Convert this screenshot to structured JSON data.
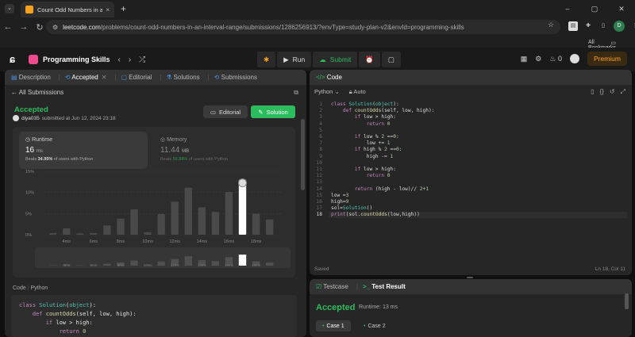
{
  "browser": {
    "tab_title": "Count Odd Numbers in an Inte",
    "tab_close": "×",
    "new_tab": "+",
    "url_host": "leetcode.com",
    "url_path": "/problems/count-odd-numbers-in-an-interval-range/submissions/1286256913/?envType=study-plan-v2&envId=programming-skills",
    "bookmarks_label": "All Bookmarks",
    "profile_letter": "D",
    "min": "–",
    "max": "▢",
    "close": "✕"
  },
  "toolbar": {
    "study_plan": "Programming Skills",
    "run": "Run",
    "submit": "Submit",
    "streak": "0",
    "premium": "Premium"
  },
  "left_panel": {
    "tabs": [
      "Description",
      "Accepted",
      "Editorial",
      "Solutions",
      "Submissions"
    ],
    "all_submissions": "All Submissions",
    "status": "Accepted",
    "user": "diya035",
    "submitted_at": "submitted at Jun 12, 2024 23:18",
    "editorial_btn": "Editorial",
    "solution_btn": "Solution",
    "runtime": {
      "label": "Runtime",
      "value": "16",
      "unit": "ms",
      "beats_prefix": "Beats",
      "beats_pct": "34.95%",
      "beats_suffix": "of users with Python"
    },
    "memory": {
      "label": "Memory",
      "value": "11.44",
      "unit": "MB",
      "beats_prefix": "Beats",
      "beats_pct": "50.88%",
      "beats_suffix": "of users with Python"
    },
    "code_header": "Code",
    "code_lang": "Python",
    "code_preview": [
      "class Solution(object):",
      "    def countOdds(self, low, high):",
      "        if low > high:",
      "            return 0"
    ]
  },
  "chart_data": {
    "type": "bar",
    "title": "",
    "xlabel": "",
    "ylabel": "",
    "y_ticks": [
      "15%",
      "10%",
      "5%",
      "0%"
    ],
    "ylim": [
      0,
      15
    ],
    "x_tick_labels": [
      "4ms",
      "6ms",
      "8ms",
      "10ms",
      "12ms",
      "14ms",
      "16ms",
      "18ms"
    ],
    "values": [
      0.4,
      1.5,
      0.3,
      0.4,
      2.2,
      3.8,
      6.0,
      0.6,
      4.9,
      7.8,
      11.1,
      6.5,
      5.4,
      10.1,
      13.0,
      5.0,
      3.6
    ],
    "highlight_index": 14,
    "grid": true
  },
  "right_panel": {
    "title": "Code",
    "lang": "Python",
    "mode": "Auto",
    "status": "Saved",
    "cursor": "Ln 18, Col 11",
    "lines": [
      "class Solution(object):",
      "    def countOdds(self, low, high):",
      "        if low > high:",
      "            return 0",
      "",
      "        if low % 2 ==0:",
      "            low += 1",
      "        if high % 2 ==0:",
      "            high -= 1",
      "",
      "        if low > high:",
      "            return 0",
      "",
      "        return (high - low)// 2+1",
      "low =3",
      "high=9",
      "sol=Solution()",
      "print(sol.countOdds(low,high))"
    ]
  },
  "bottom_panel": {
    "testcase": "Testcase",
    "test_result": "Test Result",
    "status": "Accepted",
    "runtime": "Runtime: 13 ms",
    "cases": [
      "Case 1",
      "Case 2"
    ]
  }
}
